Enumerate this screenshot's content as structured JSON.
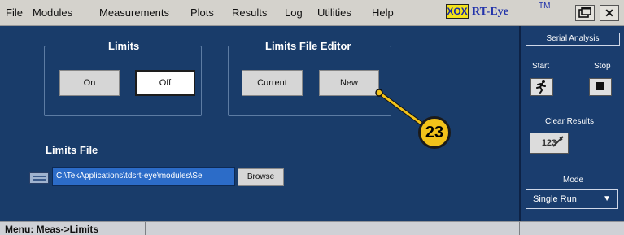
{
  "menubar": {
    "items": [
      "File",
      "Modules",
      "Measurements",
      "Plots",
      "Results",
      "Log",
      "Utilities",
      "Help"
    ],
    "logo_box": "XOX",
    "logo_text": "RT-Eye",
    "logo_tm": "TM"
  },
  "limits_group": {
    "title": "Limits",
    "on_label": "On",
    "off_label": "Off"
  },
  "editor_group": {
    "title": "Limits File Editor",
    "current_label": "Current",
    "new_label": "New"
  },
  "limits_file": {
    "label": "Limits File",
    "path_value": "C:\\TekApplications\\tdsrt-eye\\modules\\Se",
    "browse_label": "Browse"
  },
  "callout": {
    "number": "23",
    "color": "#f2c21a"
  },
  "serial": {
    "header": "Serial Analysis",
    "start_label": "Start",
    "stop_label": "Stop",
    "start_icon": "running-man-icon",
    "stop_icon": "stop-square-icon",
    "clear_label": "Clear Results",
    "clear_btn_text": "123",
    "mode_label": "Mode",
    "mode_value": "Single Run"
  },
  "status": {
    "text": "Menu: Meas->Limits"
  },
  "colors": {
    "panel": "#193c6a",
    "menubar": "#d4d2cc",
    "accent": "#2c6cc8"
  }
}
